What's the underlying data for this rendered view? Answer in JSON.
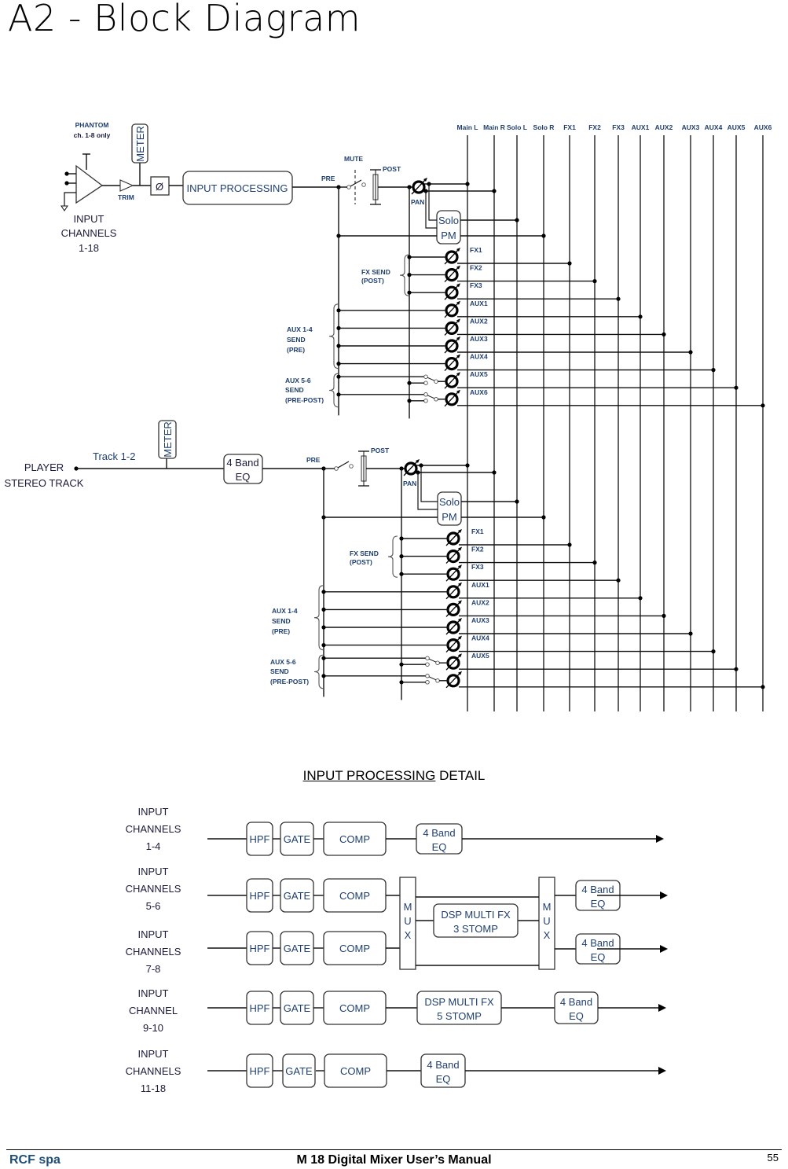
{
  "page": {
    "title": "A2 - Block Diagram",
    "detail_caption_underlined": "INPUT PROCESSING",
    "detail_caption_rest": " DETAIL"
  },
  "footer": {
    "company": "RCF spa",
    "manual_title": "M 18 Digital Mixer User’s Manual",
    "page_number": "55"
  },
  "buses": [
    "Main L",
    "Main R",
    "Solo  L",
    "Solo  R",
    "FX1",
    "FX2",
    "FX3",
    "AUX1",
    "AUX2",
    "AUX3",
    "AUX4",
    "AUX5",
    "AUX6"
  ],
  "input_strip": {
    "phantom_label": "PHANTOM",
    "phantom_note": "ch. 1-8 only",
    "meter_label": "METER",
    "trim_label": "TRIM",
    "phase_symbol": "Ø",
    "processing_label": "INPUT PROCESSING",
    "channels_label": [
      "INPUT",
      "CHANNELS",
      "1-18"
    ],
    "pre_label": "PRE",
    "mute_label": "MUTE",
    "post_label": "POST",
    "pan_label": "PAN",
    "solo_label": [
      "Solo",
      "PM"
    ],
    "fx_send_label": [
      "FX SEND",
      "(POST)"
    ],
    "aux14_label": [
      "AUX 1-4",
      "SEND",
      "(PRE)"
    ],
    "aux56_label": [
      "AUX 5-6",
      "SEND",
      "(PRE-POST)"
    ],
    "send_labels": [
      "FX1",
      "FX2",
      "FX3",
      "AUX1",
      "AUX2",
      "AUX3",
      "AUX4",
      "AUX5",
      "AUX6"
    ]
  },
  "player_strip": {
    "player_label": [
      "PLAYER",
      "STEREO TRACK"
    ],
    "track_label": "Track 1-2",
    "meter_label": "METER",
    "eq_label": [
      "4 Band",
      "EQ"
    ],
    "pre_label": "PRE",
    "post_label": "POST",
    "pan_label": "PAN",
    "solo_label": [
      "Solo",
      "PM"
    ],
    "fx_send_label": [
      "FX SEND",
      "(POST)"
    ],
    "aux14_label": [
      "AUX 1-4",
      "SEND",
      "(PRE)"
    ],
    "aux56_label": [
      "AUX 5-6",
      "SEND",
      "(PRE-POST)"
    ],
    "send_labels": [
      "FX1",
      "FX2",
      "FX3",
      "AUX1",
      "AUX2",
      "AUX3",
      "AUX4",
      "AUX5"
    ]
  },
  "processing_detail": {
    "rows": [
      {
        "label": [
          "INPUT",
          "CHANNELS",
          "1-4"
        ],
        "blocks": [
          "HPF",
          "GATE",
          "COMP",
          "4 Band|EQ"
        ]
      },
      {
        "label": [
          "INPUT",
          "CHANNELS",
          "5-6"
        ],
        "blocks": [
          "HPF",
          "GATE",
          "COMP"
        ]
      },
      {
        "label": [
          "INPUT",
          "CHANNELS",
          "7-8"
        ],
        "blocks": [
          "HPF",
          "GATE",
          "COMP"
        ]
      },
      {
        "label": [
          "INPUT",
          "CHANNEL",
          "9-10"
        ],
        "blocks": [
          "HPF",
          "GATE",
          "COMP",
          "DSP MULTI FX|5 STOMP",
          "4 Band|EQ"
        ]
      },
      {
        "label": [
          "INPUT",
          "CHANNELS",
          "11-18"
        ],
        "blocks": [
          "HPF",
          "GATE",
          "COMP",
          "4 Band|EQ"
        ]
      }
    ],
    "mux_label": [
      "M",
      "U",
      "X"
    ],
    "shared_fx_label": [
      "DSP MULTI FX",
      "3 STOMP"
    ],
    "eq_label": [
      "4 Band",
      "EQ"
    ]
  }
}
